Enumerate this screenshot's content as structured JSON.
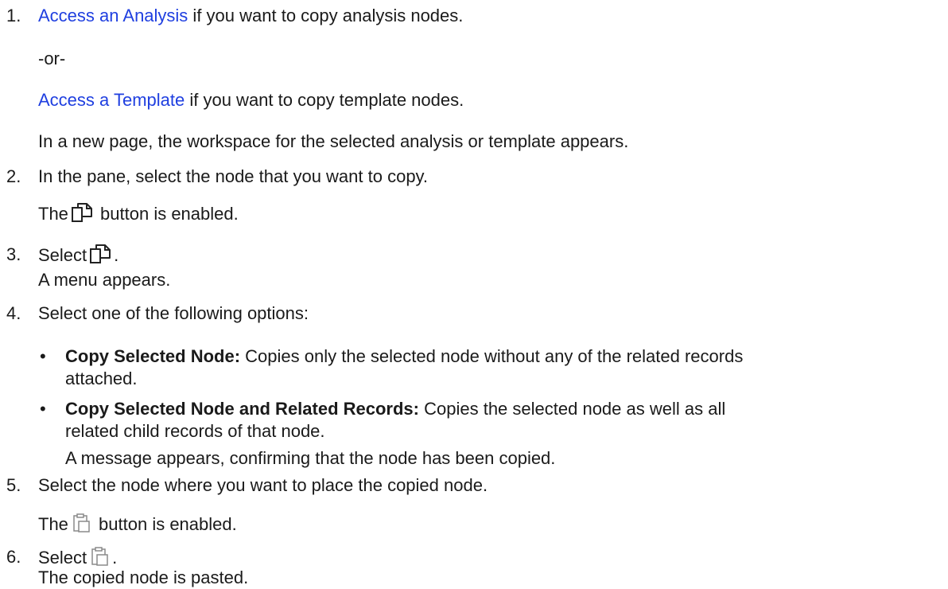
{
  "step1": {
    "number": "1.",
    "link_analysis": "Access an Analysis",
    "text_analysis": " if you want to copy analysis nodes.",
    "or": "-or-",
    "link_template": "Access a Template",
    "text_template": " if you want to copy template nodes.",
    "result": "In a new page, the workspace for the selected analysis or template appears."
  },
  "step2": {
    "number": "2.",
    "text": "In the pane, select the node that you want to copy.",
    "result_pre": "The",
    "result_post": " button is enabled."
  },
  "step3": {
    "number": "3.",
    "text_pre": "Select",
    "text_post": ".",
    "result": "A menu appears."
  },
  "step4": {
    "number": "4.",
    "text": "Select one of the following options:",
    "options": [
      {
        "term": "Copy Selected Node:",
        "desc_line1": " Copies only the selected node without any of the related records",
        "desc_line2": "attached."
      },
      {
        "term": "Copy Selected Node and Related Records:",
        "desc_line1": " Copies the selected node as well as all",
        "desc_line2": "related child records of that node."
      }
    ],
    "result": "A message appears, confirming that the node has been copied."
  },
  "step5": {
    "number": "5.",
    "text": "Select the node where you want to place the copied node.",
    "result_pre": "The",
    "result_post": " button is enabled."
  },
  "step6": {
    "number": "6.",
    "text_pre": "Select",
    "text_post": ".",
    "result": "The copied node is pasted."
  },
  "icons": {
    "copy": "copy-icon",
    "paste": "paste-icon"
  },
  "colors": {
    "link": "#1f3fe0",
    "text": "#1a1a1a"
  }
}
